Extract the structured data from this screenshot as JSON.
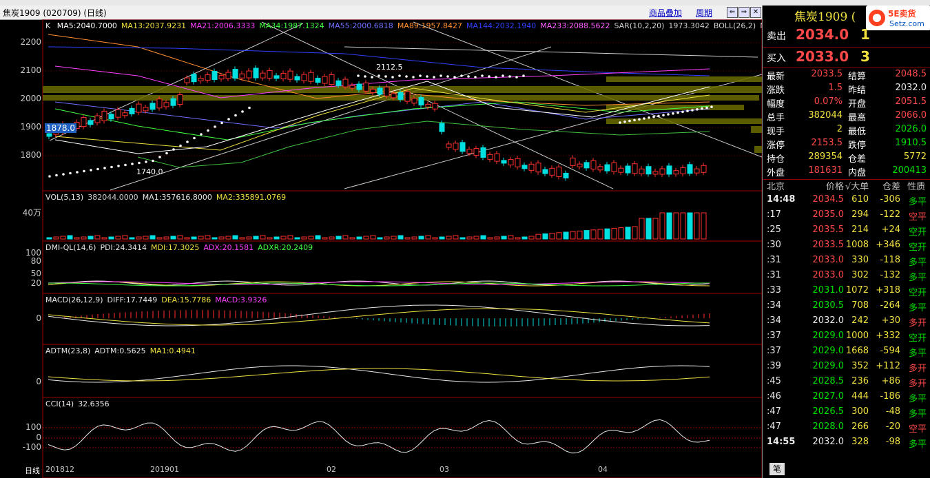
{
  "window": {
    "title": "焦炭1909 (020709) (日线)",
    "overlay": "商品叠加",
    "period": "周期"
  },
  "main_chart": {
    "label": "K",
    "ma": [
      {
        "text": "MA5:2040.7000",
        "color": "#ffffff"
      },
      {
        "text": "MA13:2037.9231",
        "color": "#f0e040"
      },
      {
        "text": "MA21:2006.3333",
        "color": "#ff40ff"
      },
      {
        "text": "MA34:1987.1324",
        "color": "#40ff40"
      },
      {
        "text": "MA55:2000.6818",
        "color": "#7070ff"
      },
      {
        "text": "MA89:1957.8427",
        "color": "#ff9030"
      },
      {
        "text": "MA144:2032.1940",
        "color": "#3040ff"
      },
      {
        "text": "MA233:2088.5622",
        "color": "#ff60ff"
      },
      {
        "text": "SAR(10,2,20)",
        "color": "#d0d0d0"
      },
      {
        "text": "1973.3042",
        "color": "#d0d0d0"
      },
      {
        "text": "BOLL(26,2)",
        "color": "#d0d0d0"
      },
      {
        "text": "M",
        "color": "#d0d0d0"
      }
    ],
    "y_ticks": [
      "2200",
      "2100",
      "2000",
      "1900",
      "1800"
    ],
    "hi_label": "2112.5",
    "lo_label": "1740.0",
    "cursor_price": "1878.0"
  },
  "volume": {
    "title": "VOL(5,13)",
    "items": [
      {
        "text": "382044.0000",
        "color": "#d0d0d0"
      },
      {
        "text": "MA1:357616.8000",
        "color": "#e8e8e8"
      },
      {
        "text": "MA2:335891.0769",
        "color": "#f0e040"
      }
    ],
    "y_label": "40万"
  },
  "dmi": {
    "title": "DMI-QL(14,6)",
    "items": [
      {
        "text": "PDI:24.3414",
        "color": "#e8e8e8"
      },
      {
        "text": "MDI:17.3025",
        "color": "#f0e040"
      },
      {
        "text": "ADX:20.1581",
        "color": "#ff40ff"
      },
      {
        "text": "ADXR:20.2409",
        "color": "#40ff40"
      }
    ],
    "y_ticks": [
      "100",
      "80",
      "50",
      "20"
    ]
  },
  "macd": {
    "title": "MACD(26,12,9)",
    "items": [
      {
        "text": "DIFF:17.7449",
        "color": "#e8e8e8"
      },
      {
        "text": "DEA:15.7786",
        "color": "#f0e040"
      },
      {
        "text": "MACD:3.9326",
        "color": "#ff40ff"
      }
    ],
    "y_ticks": [
      "0"
    ]
  },
  "adtm": {
    "title": "ADTM(23,8)",
    "items": [
      {
        "text": "ADTM:0.5625",
        "color": "#e8e8e8"
      },
      {
        "text": "MA1:0.4941",
        "color": "#f0e040"
      }
    ],
    "y_ticks": [
      "0"
    ]
  },
  "cci": {
    "title": "CCI(14)",
    "items": [
      {
        "text": "32.6356",
        "color": "#e8e8e8"
      }
    ],
    "y_ticks": [
      "100",
      "0",
      "-100"
    ]
  },
  "x_axis": {
    "period_label": "日线",
    "labels": [
      "201812",
      "201901",
      "02",
      "03",
      "04"
    ]
  },
  "panel": {
    "title": "焦炭1909 (",
    "logo": "5E卖货 Setz.com",
    "sell": {
      "label": "卖出",
      "price": "2034.0",
      "vol": "1"
    },
    "buy": {
      "label": "买入",
      "price": "2033.0",
      "vol": "3"
    },
    "quotes": [
      {
        "l1": "最新",
        "v1": "2033.5",
        "c1": "red",
        "l2": "结算",
        "v2": "2048.5",
        "c2": "red"
      },
      {
        "l1": "涨跌",
        "v1": "1.5",
        "c1": "red",
        "l2": "昨结",
        "v2": "2032.0",
        "c2": "wht"
      },
      {
        "l1": "幅度",
        "v1": "0.07%",
        "c1": "red",
        "l2": "开盘",
        "v2": "2051.5",
        "c2": "red"
      },
      {
        "l1": "总手",
        "v1": "382044",
        "c1": "yel",
        "l2": "最高",
        "v2": "2066.0",
        "c2": "red"
      },
      {
        "l1": "现手",
        "v1": "2",
        "c1": "yel",
        "l2": "最低",
        "v2": "2026.0",
        "c2": "grn"
      },
      {
        "l1": "涨停",
        "v1": "2153.5",
        "c1": "red",
        "l2": "跌停",
        "v2": "1910.5",
        "c2": "grn"
      },
      {
        "l1": "持仓",
        "v1": "289354",
        "c1": "yel",
        "l2": "仓差",
        "v2": "5772",
        "c2": "yel"
      },
      {
        "l1": "外盘",
        "v1": "181631",
        "c1": "red",
        "l2": "内盘",
        "v2": "200413",
        "c2": "grn"
      }
    ],
    "tick_header": {
      "time": "北京",
      "price": "价格",
      "big": "√大单",
      "diff": "仓差",
      "nature": "性质"
    },
    "ticks": [
      {
        "t": "14:48",
        "p": "2034.5",
        "pc": "red",
        "v": "610",
        "d": "-306",
        "dc": "yel",
        "n": "多平",
        "nc": "grn"
      },
      {
        "t": ":17",
        "p": "2035.0",
        "pc": "red",
        "v": "294",
        "d": "-122",
        "dc": "yel",
        "n": "空平",
        "nc": "red"
      },
      {
        "t": ":25",
        "p": "2035.5",
        "pc": "red",
        "v": "214",
        "d": "+24",
        "dc": "yel",
        "n": "空开",
        "nc": "grn"
      },
      {
        "t": ":30",
        "p": "2033.5",
        "pc": "red",
        "v": "1008",
        "d": "+346",
        "dc": "yel",
        "n": "空开",
        "nc": "grn"
      },
      {
        "t": ":31",
        "p": "2033.0",
        "pc": "red",
        "v": "330",
        "d": "-118",
        "dc": "yel",
        "n": "多平",
        "nc": "grn"
      },
      {
        "t": ":31",
        "p": "2033.0",
        "pc": "red",
        "v": "302",
        "d": "-132",
        "dc": "yel",
        "n": "多平",
        "nc": "grn"
      },
      {
        "t": ":33",
        "p": "2031.0",
        "pc": "grn",
        "v": "1072",
        "d": "+318",
        "dc": "yel",
        "n": "空开",
        "nc": "grn"
      },
      {
        "t": ":34",
        "p": "2030.5",
        "pc": "grn",
        "v": "708",
        "d": "-264",
        "dc": "yel",
        "n": "多平",
        "nc": "grn"
      },
      {
        "t": ":34",
        "p": "2032.0",
        "pc": "wht",
        "v": "242",
        "d": "+30",
        "dc": "yel",
        "n": "多开",
        "nc": "red"
      },
      {
        "t": ":37",
        "p": "2029.0",
        "pc": "grn",
        "v": "1000",
        "d": "+332",
        "dc": "yel",
        "n": "空开",
        "nc": "grn"
      },
      {
        "t": ":37",
        "p": "2029.0",
        "pc": "grn",
        "v": "1668",
        "d": "-594",
        "dc": "yel",
        "n": "多平",
        "nc": "grn"
      },
      {
        "t": ":39",
        "p": "2029.0",
        "pc": "grn",
        "v": "352",
        "d": "+112",
        "dc": "yel",
        "n": "多开",
        "nc": "red"
      },
      {
        "t": ":45",
        "p": "2028.5",
        "pc": "grn",
        "v": "236",
        "d": "+86",
        "dc": "yel",
        "n": "多开",
        "nc": "red"
      },
      {
        "t": ":46",
        "p": "2027.0",
        "pc": "grn",
        "v": "444",
        "d": "-186",
        "dc": "yel",
        "n": "多平",
        "nc": "grn"
      },
      {
        "t": ":47",
        "p": "2026.5",
        "pc": "grn",
        "v": "300",
        "d": "-48",
        "dc": "yel",
        "n": "多平",
        "nc": "grn"
      },
      {
        "t": ":47",
        "p": "2028.0",
        "pc": "grn",
        "v": "266",
        "d": "-20",
        "dc": "yel",
        "n": "空平",
        "nc": "red"
      },
      {
        "t": "14:55",
        "p": "2032.0",
        "pc": "wht",
        "v": "328",
        "d": "-98",
        "dc": "yel",
        "n": "多平",
        "nc": "grn"
      }
    ],
    "tab": "笔"
  }
}
